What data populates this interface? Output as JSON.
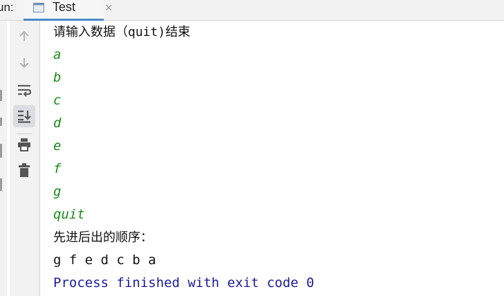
{
  "header": {
    "run_label": "un:",
    "tab_title": "Test",
    "close_glyph": "×"
  },
  "toolbar": {
    "buttons": [
      "arrow-up-icon",
      "arrow-down-icon",
      "soft-wrap-icon",
      "scroll-to-end-icon",
      "print-icon",
      "trash-icon"
    ],
    "active": "scroll-to-end-icon"
  },
  "console": {
    "prompt_pre": "请输入数据（",
    "prompt_mid": "quit)",
    "prompt_post": "结束",
    "inputs": [
      "a",
      "b",
      "c",
      "d",
      "e",
      "f",
      "g",
      "quit"
    ],
    "result_label": "先进后出的顺序：",
    "result_values": "g f e d c b a",
    "exit_message": "Process finished with exit code 0"
  },
  "colors": {
    "input_text": "#1a8a1a",
    "exit_text": "#1b1b9a",
    "accent": "#4a88c7"
  }
}
